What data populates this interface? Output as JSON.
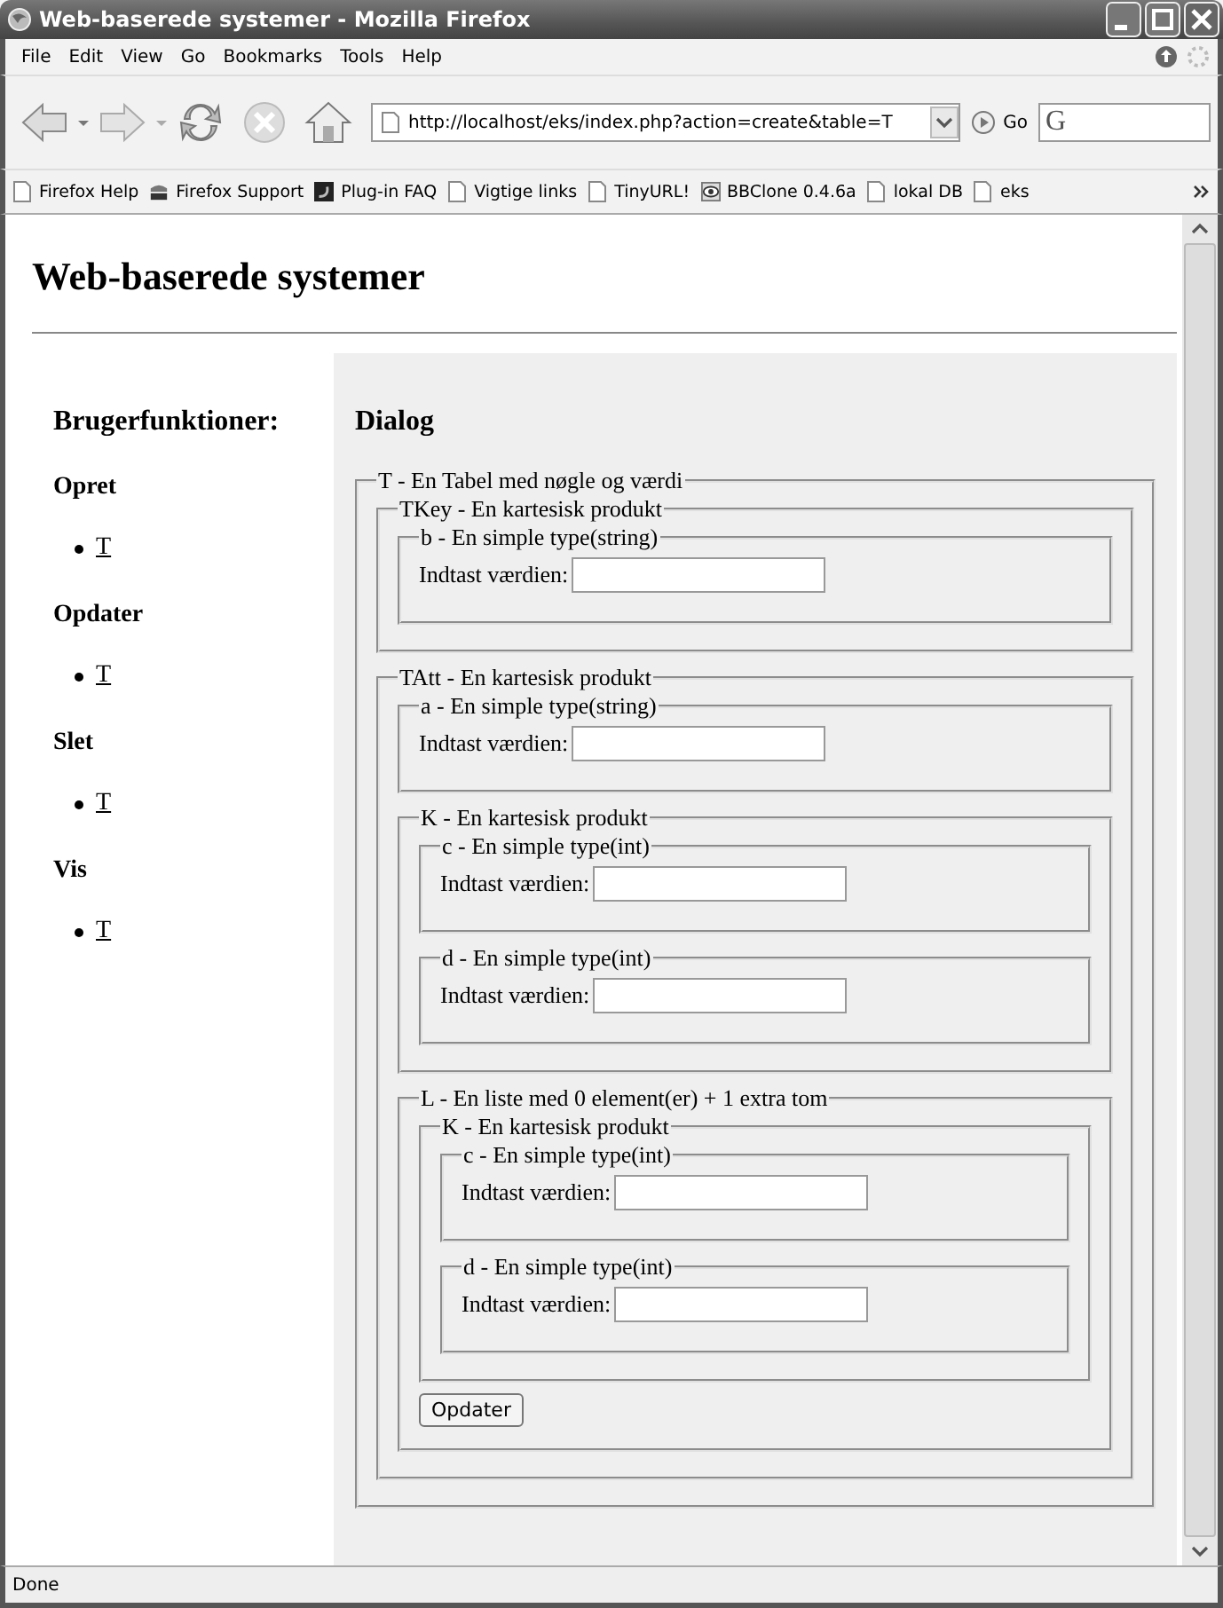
{
  "window": {
    "title": "Web-baserede systemer - Mozilla Firefox"
  },
  "menu": [
    "File",
    "Edit",
    "View",
    "Go",
    "Bookmarks",
    "Tools",
    "Help"
  ],
  "address": {
    "value": "http://localhost/eks/index.php?action=create&table=T",
    "go_label": "Go",
    "search_logo": "G"
  },
  "bookmarks": [
    {
      "label": "Firefox Help",
      "kind": "page"
    },
    {
      "label": "Firefox Support",
      "kind": "zine"
    },
    {
      "label": "Plug-in FAQ",
      "kind": "plugin"
    },
    {
      "label": "Vigtige links",
      "kind": "page"
    },
    {
      "label": "TinyURL!",
      "kind": "page"
    },
    {
      "label": "BBClone 0.4.6a",
      "kind": "eye"
    },
    {
      "label": "lokal DB",
      "kind": "page"
    },
    {
      "label": "eks",
      "kind": "page"
    }
  ],
  "page": {
    "heading": "Web-baserede systemer"
  },
  "sidebar": {
    "title": "Brugerfunktioner:",
    "sections": [
      {
        "heading": "Opret",
        "links": [
          "T"
        ]
      },
      {
        "heading": "Opdater",
        "links": [
          "T"
        ]
      },
      {
        "heading": "Slet",
        "links": [
          "T"
        ]
      },
      {
        "heading": "Vis",
        "links": [
          "T"
        ]
      }
    ]
  },
  "dialog": {
    "title": "Dialog",
    "form": {
      "kind": "group",
      "legend": "T - En Tabel med nøgle og værdi",
      "children": [
        {
          "kind": "group",
          "legend": "TKey - En kartesisk produkt",
          "children": [
            {
              "kind": "group",
              "legend": "b - En simple type(string)",
              "children": [
                {
                  "kind": "field",
                  "label": "Indtast værdien:"
                }
              ]
            }
          ]
        },
        {
          "kind": "group",
          "legend": "TAtt - En kartesisk produkt",
          "children": [
            {
              "kind": "group",
              "legend": "a - En simple type(string)",
              "children": [
                {
                  "kind": "field",
                  "label": "Indtast værdien:"
                }
              ]
            },
            {
              "kind": "group",
              "legend": "K - En kartesisk produkt",
              "children": [
                {
                  "kind": "group",
                  "legend": "c - En simple type(int)",
                  "children": [
                    {
                      "kind": "field",
                      "label": "Indtast værdien:"
                    }
                  ]
                },
                {
                  "kind": "group",
                  "legend": "d - En simple type(int)",
                  "children": [
                    {
                      "kind": "field",
                      "label": "Indtast værdien:"
                    }
                  ]
                }
              ]
            },
            {
              "kind": "group",
              "legend": "L - En liste med 0 element(er) + 1 extra tom",
              "children": [
                {
                  "kind": "group",
                  "legend": "K - En kartesisk produkt",
                  "children": [
                    {
                      "kind": "group",
                      "legend": "c - En simple type(int)",
                      "children": [
                        {
                          "kind": "field",
                          "label": "Indtast værdien:"
                        }
                      ]
                    },
                    {
                      "kind": "group",
                      "legend": "d - En simple type(int)",
                      "children": [
                        {
                          "kind": "field",
                          "label": "Indtast værdien:"
                        }
                      ]
                    }
                  ]
                },
                {
                  "kind": "button",
                  "label": "Opdater"
                }
              ]
            }
          ]
        }
      ]
    }
  },
  "status_bar": {
    "text": "Done"
  }
}
